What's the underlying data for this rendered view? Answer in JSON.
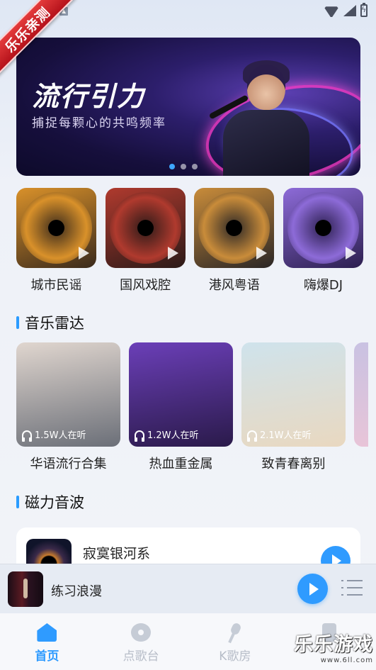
{
  "watermark_corner": "乐乐亲测",
  "banner": {
    "title": "流行引力",
    "subtitle": "捕捉每颗心的共鸣频率",
    "dots": 3,
    "active_dot": 0
  },
  "genres": [
    {
      "label": "城市民谣",
      "colors": [
        "#d9912a",
        "#3a2a1c"
      ]
    },
    {
      "label": "国风戏腔",
      "colors": [
        "#b03a2e",
        "#2b1a18"
      ]
    },
    {
      "label": "港风粤语",
      "colors": [
        "#c98c3a",
        "#2a2626"
      ]
    },
    {
      "label": "嗨爆DJ",
      "colors": [
        "#8d6bd8",
        "#2c1f4f"
      ]
    }
  ],
  "sections": {
    "radar_title": "音乐雷达",
    "magnet_title": "磁力音波"
  },
  "radar": [
    {
      "label": "华语流行合集",
      "listeners": "1.5W人在听",
      "colors": [
        "#e0d6cf",
        "#6b6f78"
      ]
    },
    {
      "label": "热血重金属",
      "listeners": "1.2W人在听",
      "colors": [
        "#6b3fb8",
        "#2a1a4a"
      ]
    },
    {
      "label": "致青春离别",
      "listeners": "2.1W人在听",
      "colors": [
        "#cfe3ec",
        "#e9d8c0"
      ]
    }
  ],
  "song": {
    "title": "寂寞银河系"
  },
  "mini_player": {
    "title": "练习浪漫"
  },
  "tabs": [
    {
      "label": "首页",
      "icon": "home-icon",
      "active": true
    },
    {
      "label": "点歌台",
      "icon": "disc-icon",
      "active": false
    },
    {
      "label": "K歌房",
      "icon": "mic-icon",
      "active": false
    },
    {
      "label": "",
      "icon": "note-icon",
      "active": false
    }
  ],
  "watermark": {
    "main": "乐乐游戏",
    "url": "www.6ll.com"
  },
  "colors": {
    "accent": "#2f9bff",
    "ribbon": "#d42a2a"
  }
}
